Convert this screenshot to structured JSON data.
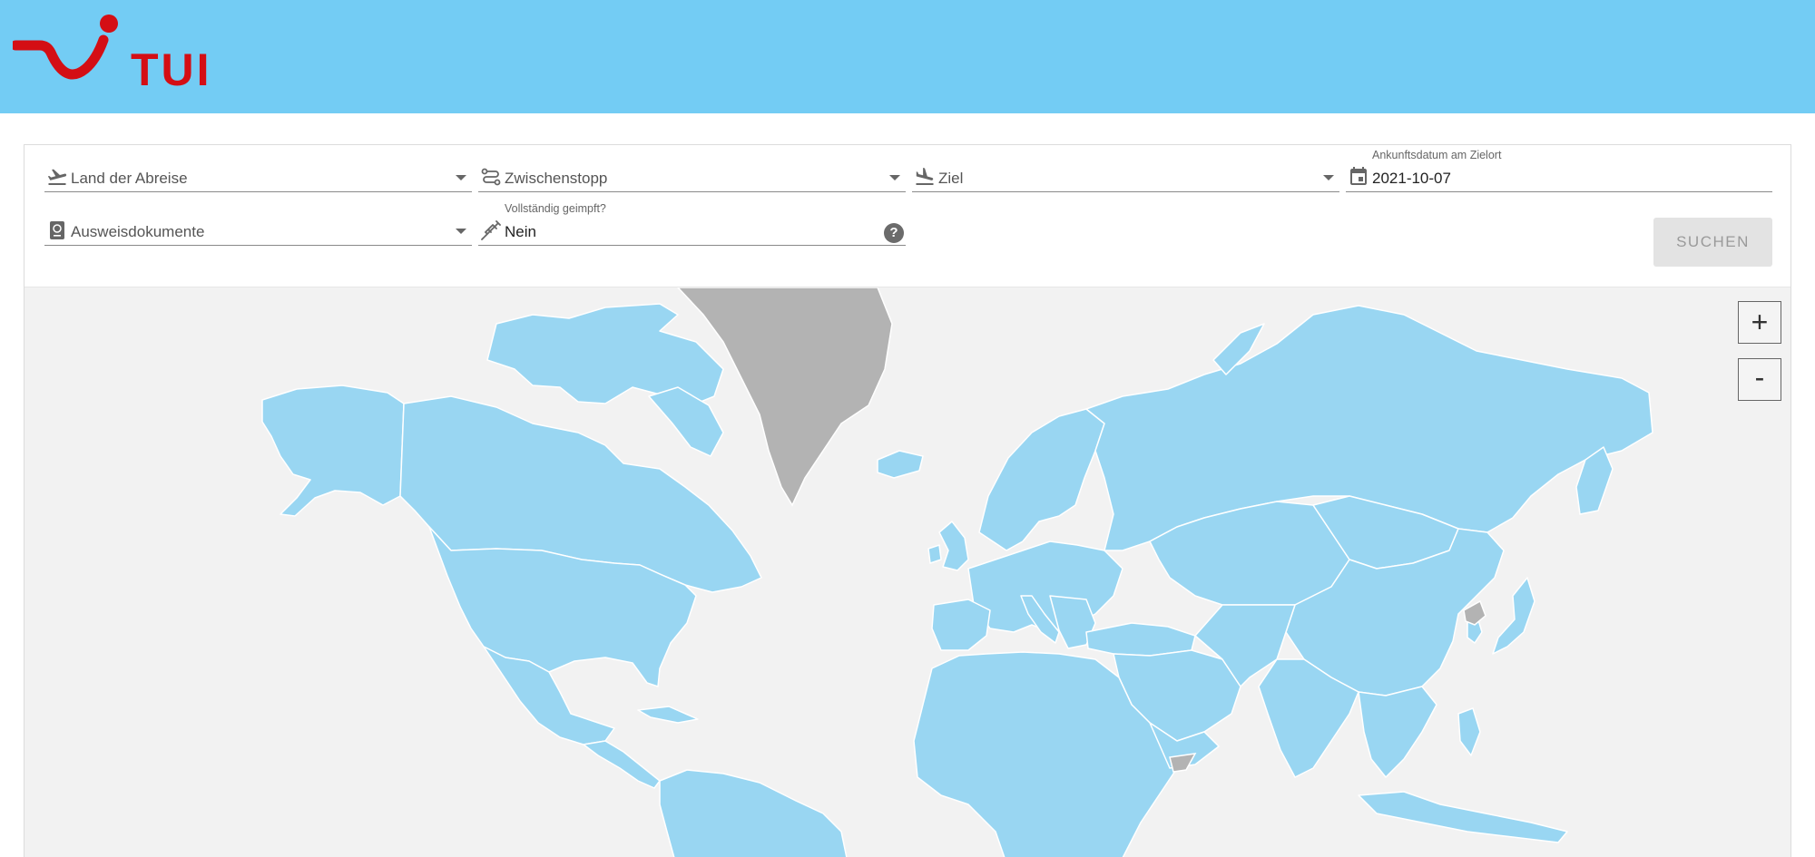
{
  "brand": {
    "name": "TUI",
    "color": "#d40e14",
    "header_color": "#73ccf4"
  },
  "form": {
    "departure": {
      "label": "Land der Abreise",
      "icon": "airplane-takeoff-icon"
    },
    "stopover": {
      "label": "Zwischenstopp",
      "icon": "route-icon"
    },
    "destination": {
      "label": "Ziel",
      "icon": "airplane-landing-icon"
    },
    "arrival_date": {
      "label": "Ankunftsdatum am Zielort",
      "value": "2021-10-07",
      "icon": "calendar-icon"
    },
    "documents": {
      "label": "Ausweisdokumente",
      "icon": "passport-icon"
    },
    "vaccinated": {
      "label": "Vollständig geimpft?",
      "value": "Nein",
      "icon": "syringe-icon",
      "help": "?"
    },
    "search_label": "SUCHEN"
  },
  "map": {
    "zoom_in": "+",
    "zoom_out": "-",
    "country_color": "#99d6f2",
    "inactive_color": "#b3b3b3",
    "background": "#f2f2f2"
  }
}
